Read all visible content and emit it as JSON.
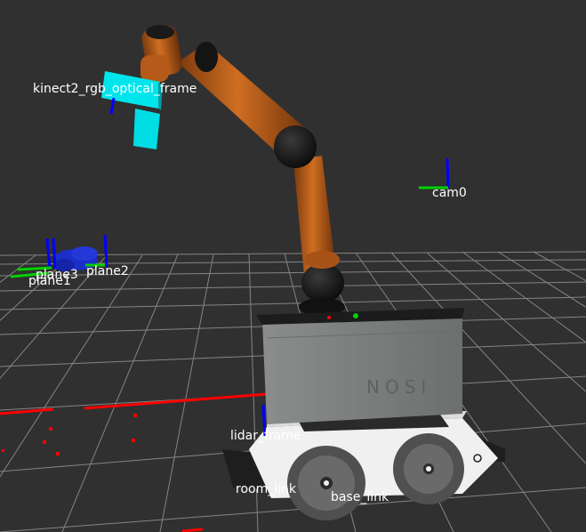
{
  "scene": {
    "background": "#303030",
    "grid_color": "#a0a0a0",
    "frames": {
      "kinect": "kinect2_rgb_optical_frame",
      "cam0": "cam0",
      "plane3": "plane3",
      "plane1": "plane1",
      "plane2": "plane2",
      "lidar": "lidar_frame",
      "room": "room_link",
      "base": "base_link"
    },
    "base_logo": "NOSI",
    "colors": {
      "arm_orange": "#c0601a",
      "arm_black": "#141414",
      "camera_cyan": "#00e5ec",
      "axis_red": "#ff0000",
      "axis_green": "#00d000",
      "axis_blue": "#0000ff",
      "marker_blue": "#1a2fc8",
      "base_gray": "#7d807f",
      "chassis_white": "#f0f0f0",
      "wheel_gray": "#555555"
    }
  }
}
